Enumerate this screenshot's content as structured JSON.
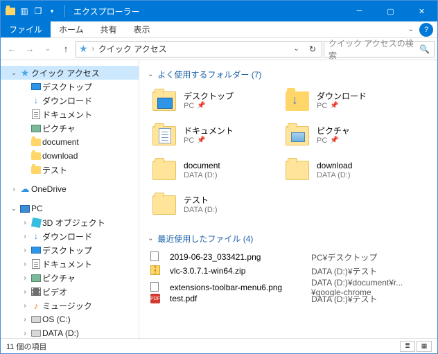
{
  "window": {
    "title": "エクスプローラー"
  },
  "ribbon": {
    "file": "ファイル",
    "tabs": [
      "ホーム",
      "共有",
      "表示"
    ]
  },
  "address": {
    "location": "クイック アクセス",
    "search_placeholder": "クイック アクセスの検索"
  },
  "sidebar": {
    "quick_access": "クイック アクセス",
    "qa_items": [
      "デスクトップ",
      "ダウンロード",
      "ドキュメント",
      "ピクチャ",
      "document",
      "download",
      "テスト"
    ],
    "onedrive": "OneDrive",
    "pc": "PC",
    "pc_items": [
      "3D オブジェクト",
      "ダウンロード",
      "デスクトップ",
      "ドキュメント",
      "ピクチャ",
      "ビデオ",
      "ミュージック",
      "OS (C:)",
      "DATA (D:)"
    ]
  },
  "sections": {
    "folders_header": "よく使用するフォルダー (7)",
    "recent_header": "最近使用したファイル (4)"
  },
  "folders": [
    {
      "name": "デスクトップ",
      "loc": "PC",
      "pin": true,
      "kind": "desktop"
    },
    {
      "name": "ダウンロード",
      "loc": "PC",
      "pin": true,
      "kind": "download"
    },
    {
      "name": "ドキュメント",
      "loc": "PC",
      "pin": true,
      "kind": "document"
    },
    {
      "name": "ピクチャ",
      "loc": "PC",
      "pin": true,
      "kind": "picture"
    },
    {
      "name": "document",
      "loc": "DATA (D:)",
      "pin": false,
      "kind": "folder"
    },
    {
      "name": "download",
      "loc": "DATA (D:)",
      "pin": false,
      "kind": "folder"
    },
    {
      "name": "テスト",
      "loc": "DATA (D:)",
      "pin": false,
      "kind": "folder"
    }
  ],
  "recent": [
    {
      "name": "2019-06-23_033421.png",
      "loc": "PC¥デスクトップ",
      "kind": "png"
    },
    {
      "name": "vlc-3.0.7.1-win64.zip",
      "loc": "DATA (D:)¥テスト",
      "kind": "zip"
    },
    {
      "name": "extensions-toolbar-menu6.png",
      "loc": "DATA (D:)¥document¥r...¥google-chrome",
      "kind": "png"
    },
    {
      "name": "test.pdf",
      "loc": "DATA (D:)¥テスト",
      "kind": "pdf"
    }
  ],
  "status": {
    "text": "11 個の項目"
  }
}
